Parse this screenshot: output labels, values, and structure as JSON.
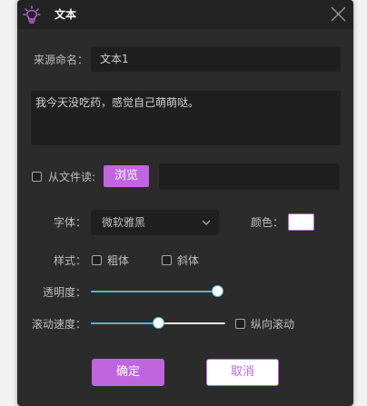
{
  "window": {
    "title": "文本",
    "icon": "lightbulb-icon",
    "close_icon": "close-icon"
  },
  "source": {
    "label": "来源命名：",
    "value": "文本1"
  },
  "text_content": {
    "value": "我今天没吃药，感觉自己萌萌哒。"
  },
  "file": {
    "checkbox_label": "从文件读:",
    "checked": false,
    "browse_label": "浏览",
    "path_value": ""
  },
  "font": {
    "label": "字体：",
    "selected": "微软雅黑",
    "color_label": "颜色：",
    "color_value": "#ffffff"
  },
  "style": {
    "label": "样式：",
    "bold_label": "粗体",
    "bold_checked": false,
    "italic_label": "斜体",
    "italic_checked": false
  },
  "opacity": {
    "label": "透明度：",
    "value": 1.0
  },
  "scroll": {
    "label": "滚动速度：",
    "value": 0.5,
    "vertical_label": "纵向滚动",
    "vertical_checked": false
  },
  "actions": {
    "ok_label": "确定",
    "cancel_label": "取消"
  },
  "colors": {
    "accent": "#c064e0",
    "slider": "#4fb3e0",
    "background": "#2b2b2b",
    "field": "#1f1f1f"
  }
}
